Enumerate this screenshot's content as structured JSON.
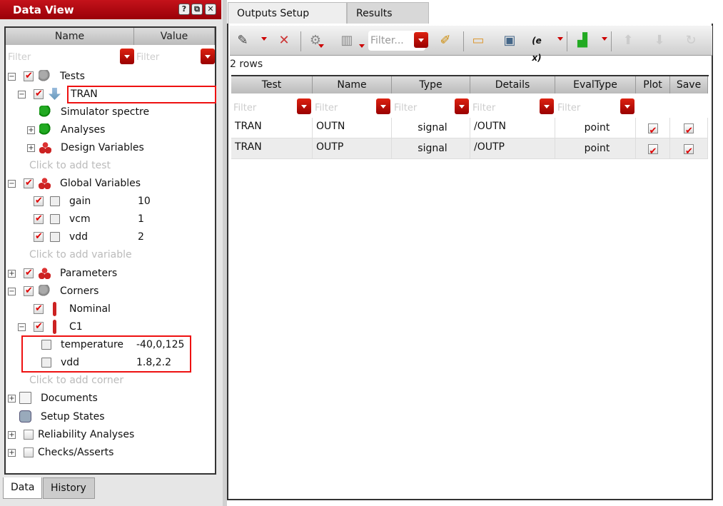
{
  "left_panel": {
    "title": "Data View",
    "title_buttons": [
      "?",
      "⧉",
      "✕"
    ],
    "columns": {
      "name": "Name",
      "value": "Value"
    },
    "filter_placeholder": "Filter",
    "tree": {
      "tests": "Tests",
      "tran": "TRAN",
      "simulator": "Simulator  spectre",
      "analyses": "Analyses",
      "design_variables": "Design Variables",
      "add_test": "Click to add test",
      "global_variables": "Global Variables",
      "vars": [
        {
          "name": "gain",
          "value": "10"
        },
        {
          "name": "vcm",
          "value": "1"
        },
        {
          "name": "vdd",
          "value": "2"
        }
      ],
      "add_variable": "Click to add variable",
      "parameters": "Parameters",
      "corners": "Corners",
      "nominal": "Nominal",
      "c1": "C1",
      "corner_vars": [
        {
          "name": "temperature",
          "value": "-40,0,125"
        },
        {
          "name": "vdd",
          "value": "1.8,2.2"
        }
      ],
      "add_corner": "Click to add corner",
      "documents": "Documents",
      "setup_states": "Setup States",
      "reliability": "Reliability Analyses",
      "checks": "Checks/Asserts"
    },
    "bottom_tabs": [
      "Data",
      "History"
    ]
  },
  "right_panel": {
    "tabs": [
      "Outputs Setup",
      "Results"
    ],
    "toolbar": {
      "filter_placeholder": "Filter..."
    },
    "row_count": "2 rows",
    "columns": [
      "Test",
      "Name",
      "Type",
      "Details",
      "EvalType",
      "Plot",
      "Save"
    ],
    "filter_placeholder": "Filter",
    "rows": [
      {
        "test": "TRAN",
        "name": "OUTN",
        "type": "signal",
        "details": "/OUTN",
        "evaltype": "point",
        "plot": true,
        "save": true
      },
      {
        "test": "TRAN",
        "name": "OUTP",
        "type": "signal",
        "details": "/OUTP",
        "evaltype": "point",
        "plot": true,
        "save": true
      }
    ]
  },
  "colors": {
    "accent": "#b5000b",
    "highlight": "#e11111"
  }
}
